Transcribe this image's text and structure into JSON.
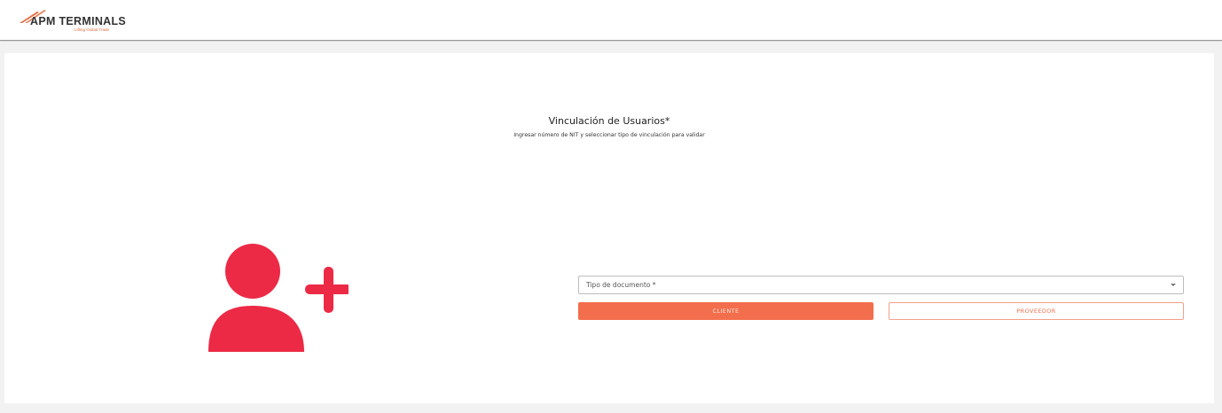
{
  "header": {
    "logo_text": "APM TERMINALS",
    "logo_tagline": "Lifting Global Trade"
  },
  "main": {
    "title": "Vinculación de Usuarios*",
    "subtitle": "Ingresar número de NIT y seleccionar tipo de vinculación para validar",
    "document_type_select": {
      "label": "Tipo de documento *",
      "value": ""
    },
    "buttons": {
      "cliente": "CLIENTE",
      "proveedor": "PROVEEDOR"
    }
  },
  "colors": {
    "accent": "#f26e4c",
    "icon_red": "#ec2a46",
    "logo_orange": "#e36b3e"
  },
  "icons": {
    "illustration": "add-user-icon",
    "dropdown": "chevron-down-icon"
  }
}
